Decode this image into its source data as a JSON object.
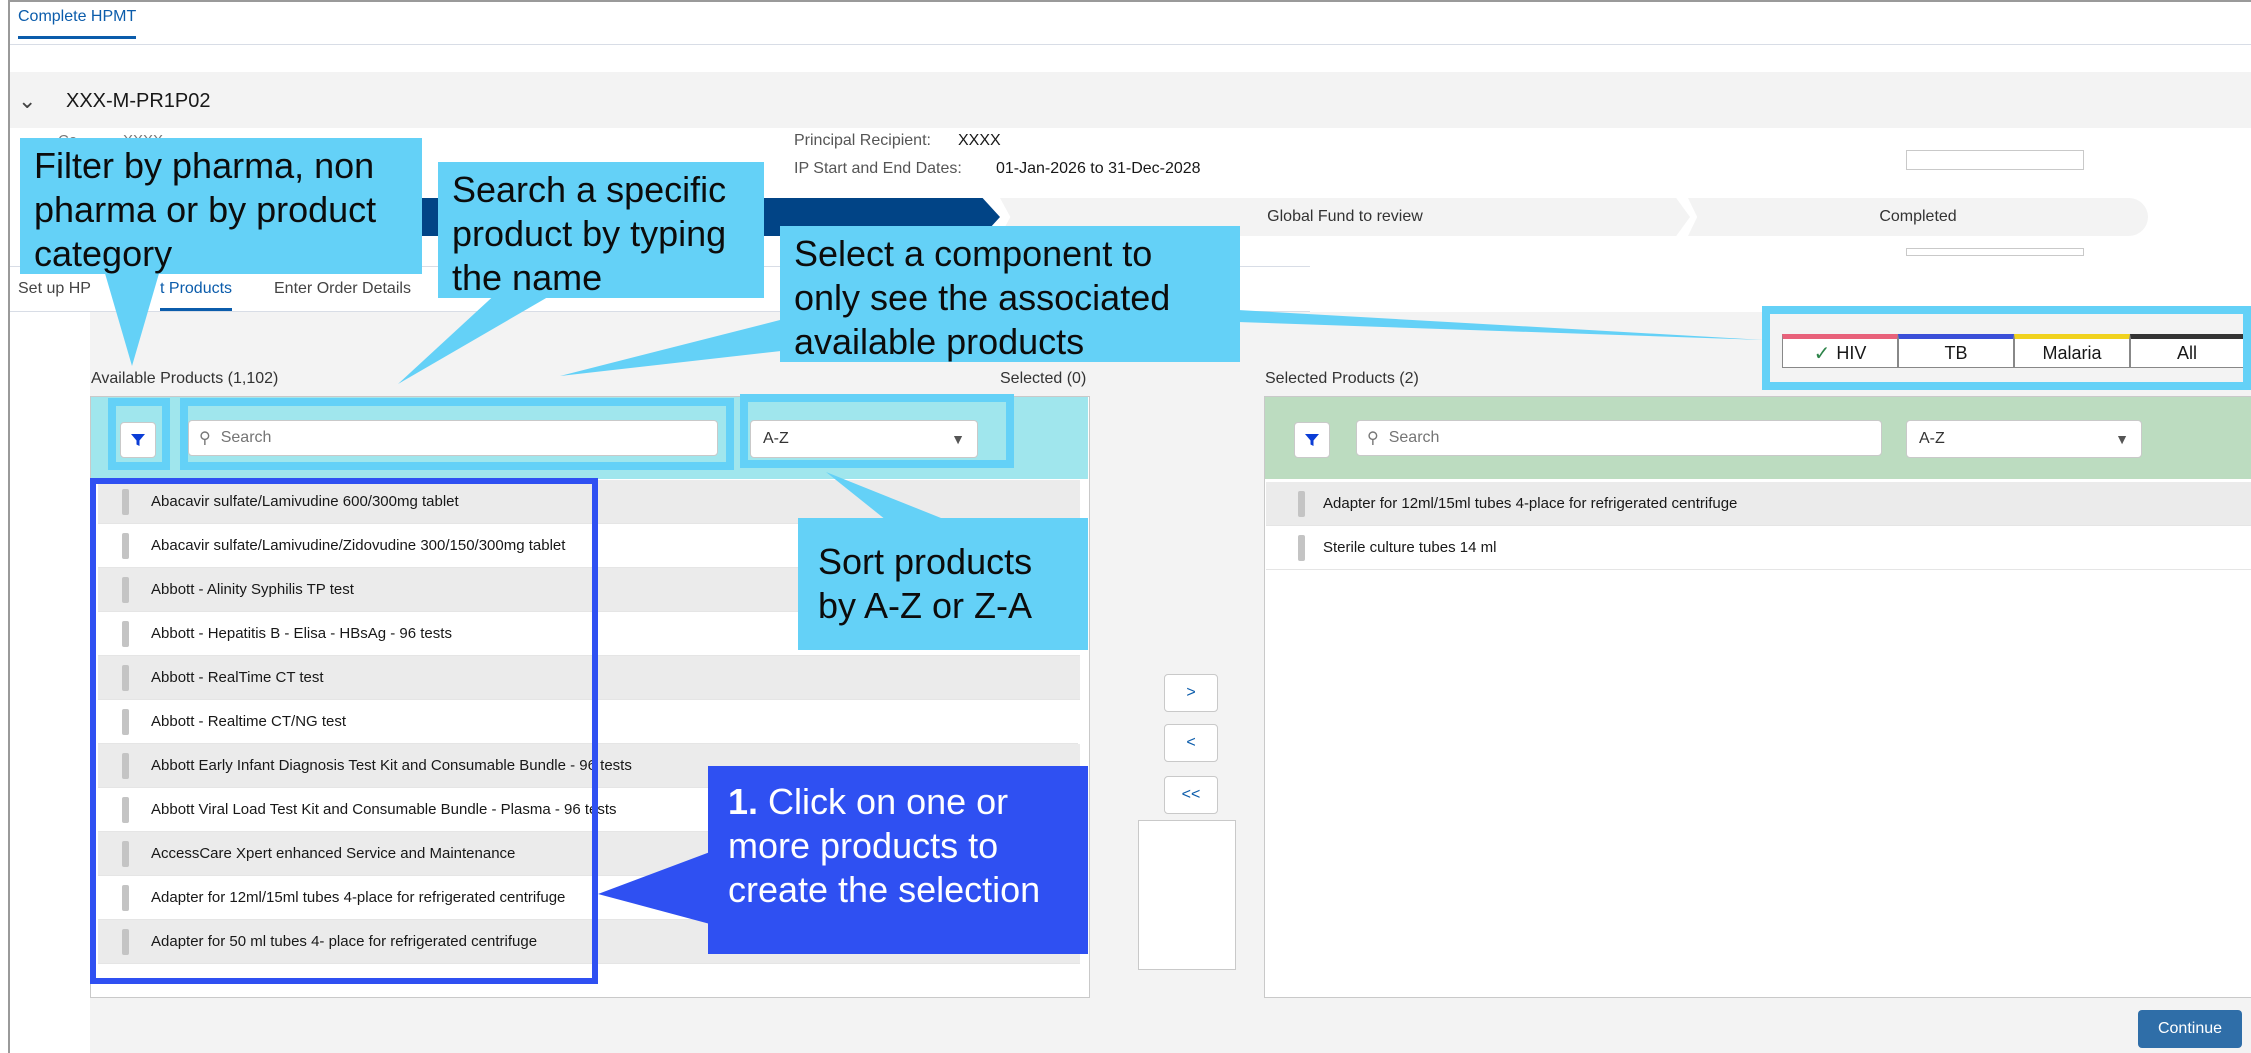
{
  "tab": {
    "label": "Complete HPMT"
  },
  "grant": {
    "code": "XXX-M-PR1P02",
    "partial_field": "Co...... ... XXXX"
  },
  "info": {
    "pr_label": "Principal Recipient:",
    "pr_value": "XXXX",
    "dates_label": "IP Start and End Dates:",
    "dates_value": "01-Jan-2026 to 31-Dec-2028"
  },
  "path": {
    "step_gf": "Global Fund to review",
    "step_done": "Completed"
  },
  "subtabs": {
    "setup": "Set up HP",
    "select": "t Products",
    "order": "Enter Order Details"
  },
  "available": {
    "title": "Available Products (1,102)",
    "selected_count": "Selected (0)",
    "search_placeholder": "Search",
    "sort_value": "A-Z",
    "items": [
      "Abacavir sulfate/Lamivudine 600/300mg tablet",
      "Abacavir sulfate/Lamivudine/Zidovudine 300/150/300mg tablet",
      "Abbott - Alinity Syphilis TP test",
      "Abbott - Hepatitis B - Elisa - HBsAg - 96 tests",
      "Abbott - RealTime CT test",
      "Abbott - Realtime CT/NG test",
      "Abbott Early Infant Diagnosis Test Kit and Consumable Bundle - 96 tests",
      "Abbott Viral Load Test Kit and Consumable Bundle - Plasma - 96 tests",
      "AccessCare Xpert enhanced Service and Maintenance",
      "Adapter for 12ml/15ml tubes 4-place for refrigerated centrifuge",
      "Adapter for 50 ml tubes 4- place for refrigerated centrifuge"
    ]
  },
  "selected": {
    "title": "Selected Products (2)",
    "search_placeholder": "Search",
    "sort_value": "A-Z",
    "items": [
      "Adapter for 12ml/15ml tubes 4-place for refrigerated centrifuge",
      "Sterile culture tubes 14 ml"
    ]
  },
  "move_buttons": {
    "add": ">",
    "remove": "<",
    "remove_all": "<<"
  },
  "components": [
    {
      "label": "HIV",
      "color": "#e8617a",
      "checked": true
    },
    {
      "label": "TB",
      "color": "#3b4fd8"
    },
    {
      "label": "Malaria",
      "color": "#f0d21e"
    },
    {
      "label": "All",
      "color": "#333333"
    }
  ],
  "continue_label": "Continue",
  "annotations": {
    "filter": "Filter by pharma, non pharma or by product category",
    "search": "Search a specific product by typing the name",
    "component": "Select a component to only see the associated available products",
    "sort": "Sort products by A-Z or Z-A",
    "step_number": "1.",
    "step_text": "Click on one or more products to create the selection"
  },
  "colors": {
    "callout": "#64d1f7",
    "step_callout": "#2f50f2",
    "brand": "#0b5cab",
    "path_active": "#014486"
  }
}
